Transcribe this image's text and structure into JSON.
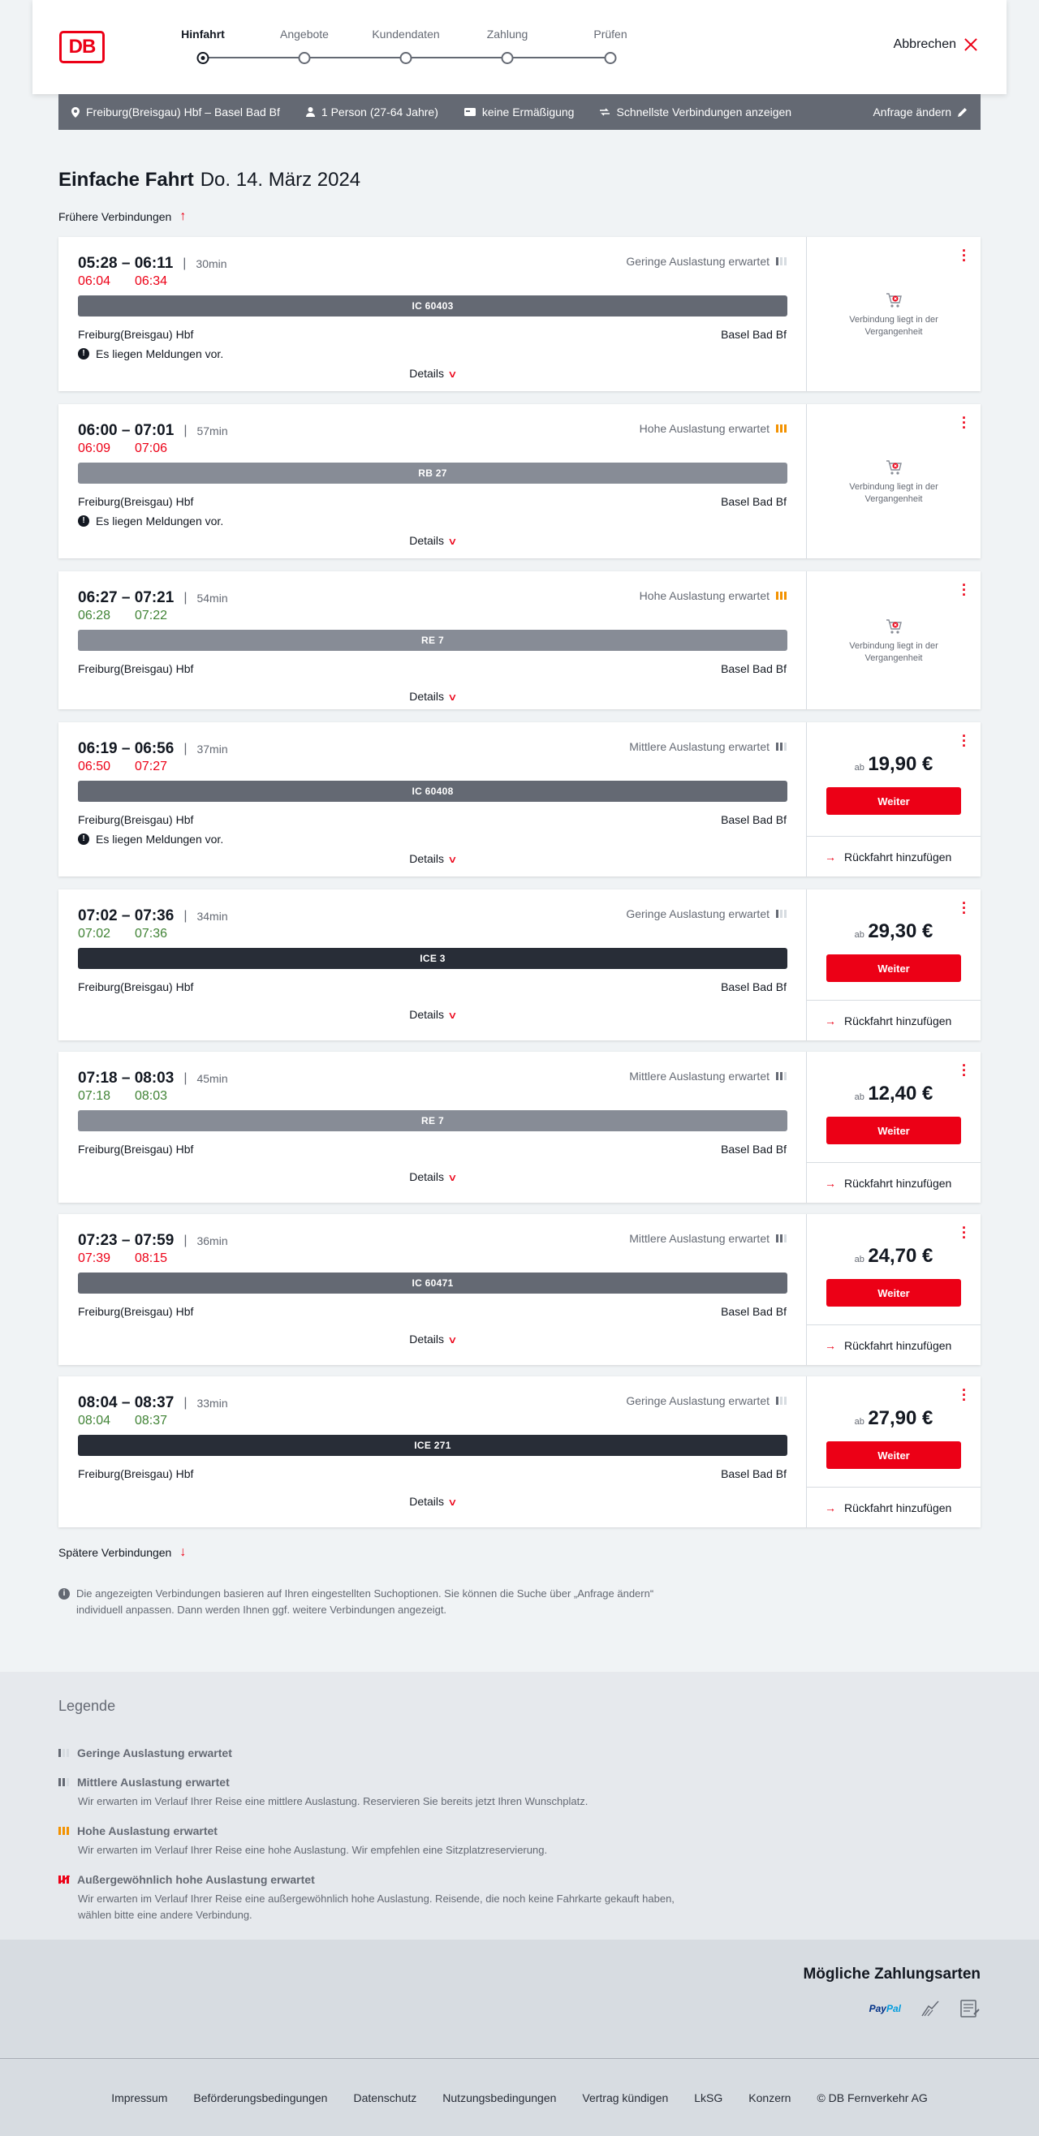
{
  "header": {
    "logo_text": "DB",
    "steps": [
      "Hinfahrt",
      "Angebote",
      "Kundendaten",
      "Zahlung",
      "Prüfen"
    ],
    "cancel_label": "Abbrechen"
  },
  "summary": {
    "route": "Freiburg(Breisgau) Hbf – Basel Bad Bf",
    "passengers": "1 Person (27-64 Jahre)",
    "discount": "keine Ermäßigung",
    "fastest": "Schnellste Verbindungen anzeigen",
    "change": "Anfrage ändern"
  },
  "title": {
    "type": "Einfache Fahrt",
    "date": "Do. 14. März 2024"
  },
  "earlier_label": "Frühere Verbindungen",
  "later_label": "Spätere Verbindungen",
  "connections": [
    {
      "times": "05:28 – 06:11",
      "duration": "30min",
      "rt_dep": "06:04",
      "rt_arr": "06:34",
      "rt_status": "late",
      "load": "Geringe Auslastung erwartet",
      "load_level": 1,
      "train": "IC 60403",
      "train_type": "ic",
      "from": "Freiburg(Breisgau) Hbf",
      "to": "Basel Bad Bf",
      "message": "Es liegen Meldungen vor.",
      "details": "Details",
      "past": "Verbindung liegt in der Vergangenheit"
    },
    {
      "times": "06:00 – 07:01",
      "duration": "57min",
      "rt_dep": "06:09",
      "rt_arr": "07:06",
      "rt_status": "late",
      "load": "Hohe Auslastung erwartet",
      "load_level": 3,
      "train": "RB 27",
      "train_type": "reg",
      "from": "Freiburg(Breisgau) Hbf",
      "to": "Basel Bad Bf",
      "message": "Es liegen Meldungen vor.",
      "details": "Details",
      "past": "Verbindung liegt in der Vergangenheit"
    },
    {
      "times": "06:27 – 07:21",
      "duration": "54min",
      "rt_dep": "06:28",
      "rt_arr": "07:22",
      "rt_status": "ok",
      "load": "Hohe Auslastung erwartet",
      "load_level": 3,
      "train": "RE 7",
      "train_type": "reg",
      "from": "Freiburg(Breisgau) Hbf",
      "to": "Basel Bad Bf",
      "details": "Details",
      "past": "Verbindung liegt in der Vergangenheit"
    },
    {
      "times": "06:19 – 06:56",
      "duration": "37min",
      "rt_dep": "06:50",
      "rt_arr": "07:27",
      "rt_status": "late",
      "load": "Mittlere Auslastung erwartet",
      "load_level": 2,
      "train": "IC 60408",
      "train_type": "ic",
      "from": "Freiburg(Breisgau) Hbf",
      "to": "Basel Bad Bf",
      "message": "Es liegen Meldungen vor.",
      "details": "Details",
      "price_prefix": "ab",
      "price": "19,90 €",
      "button": "Weiter",
      "return_label": "Rückfahrt hinzufügen"
    },
    {
      "times": "07:02 – 07:36",
      "duration": "34min",
      "rt_dep": "07:02",
      "rt_arr": "07:36",
      "rt_status": "ok",
      "load": "Geringe Auslastung erwartet",
      "load_level": 1,
      "train": "ICE 3",
      "train_type": "ice",
      "from": "Freiburg(Breisgau) Hbf",
      "to": "Basel Bad Bf",
      "details": "Details",
      "price_prefix": "ab",
      "price": "29,30 €",
      "button": "Weiter",
      "return_label": "Rückfahrt hinzufügen"
    },
    {
      "times": "07:18 – 08:03",
      "duration": "45min",
      "rt_dep": "07:18",
      "rt_arr": "08:03",
      "rt_status": "ok",
      "load": "Mittlere Auslastung erwartet",
      "load_level": 2,
      "train": "RE 7",
      "train_type": "reg",
      "from": "Freiburg(Breisgau) Hbf",
      "to": "Basel Bad Bf",
      "details": "Details",
      "price_prefix": "ab",
      "price": "12,40 €",
      "button": "Weiter",
      "return_label": "Rückfahrt hinzufügen"
    },
    {
      "times": "07:23 – 07:59",
      "duration": "36min",
      "rt_dep": "07:39",
      "rt_arr": "08:15",
      "rt_status": "late",
      "load": "Mittlere Auslastung erwartet",
      "load_level": 2,
      "train": "IC 60471",
      "train_type": "ic",
      "from": "Freiburg(Breisgau) Hbf",
      "to": "Basel Bad Bf",
      "details": "Details",
      "price_prefix": "ab",
      "price": "24,70 €",
      "button": "Weiter",
      "return_label": "Rückfahrt hinzufügen"
    },
    {
      "times": "08:04 – 08:37",
      "duration": "33min",
      "rt_dep": "08:04",
      "rt_arr": "08:37",
      "rt_status": "ok",
      "load": "Geringe Auslastung erwartet",
      "load_level": 1,
      "train": "ICE 271",
      "train_type": "ice",
      "from": "Freiburg(Breisgau) Hbf",
      "to": "Basel Bad Bf",
      "details": "Details",
      "price_prefix": "ab",
      "price": "27,90 €",
      "button": "Weiter",
      "return_label": "Rückfahrt hinzufügen"
    }
  ],
  "info_text": "Die angezeigten Verbindungen basieren auf Ihren eingestellten Suchoptionen. Sie können die Suche über „Anfrage ändern“ individuell anpassen. Dann werden Ihnen ggf. weitere Verbindungen angezeigt.",
  "legend": {
    "title": "Legende",
    "items": [
      {
        "title": "Geringe Auslastung erwartet",
        "text": "",
        "level": 1
      },
      {
        "title": "Mittlere Auslastung erwartet",
        "text": "Wir erwarten im Verlauf Ihrer Reise eine mittlere Auslastung. Reservieren Sie bereits jetzt Ihren Wunschplatz.",
        "level": 2
      },
      {
        "title": "Hohe Auslastung erwartet",
        "text": "Wir erwarten im Verlauf Ihrer Reise eine hohe Auslastung. Wir empfehlen eine Sitzplatzreservierung.",
        "level": 3
      },
      {
        "title": "Außergewöhnlich hohe Auslastung erwartet",
        "text": "Wir erwarten im Verlauf Ihrer Reise eine außergewöhnlich hohe Auslastung. Reisende, die noch keine Fahrkarte gekauft haben, wählen bitte eine andere Verbindung.",
        "level": 4
      }
    ]
  },
  "payment": {
    "title": "Mögliche Zahlungsarten",
    "methods": [
      "PayPal",
      "lastschrift-icon",
      "rechnung-icon"
    ],
    "paypal_a": "Pay",
    "paypal_b": "Pal"
  },
  "footer": [
    "Impressum",
    "Beförderungsbedingungen",
    "Datenschutz",
    "Nutzungsbedingungen",
    "Vertrag kündigen",
    "LkSG",
    "Konzern",
    "© DB Fernverkehr AG"
  ],
  "colors": {
    "brand": "#ec0016",
    "late": "#ec0016",
    "on_time": "#408335",
    "high_load": "#f39200"
  }
}
